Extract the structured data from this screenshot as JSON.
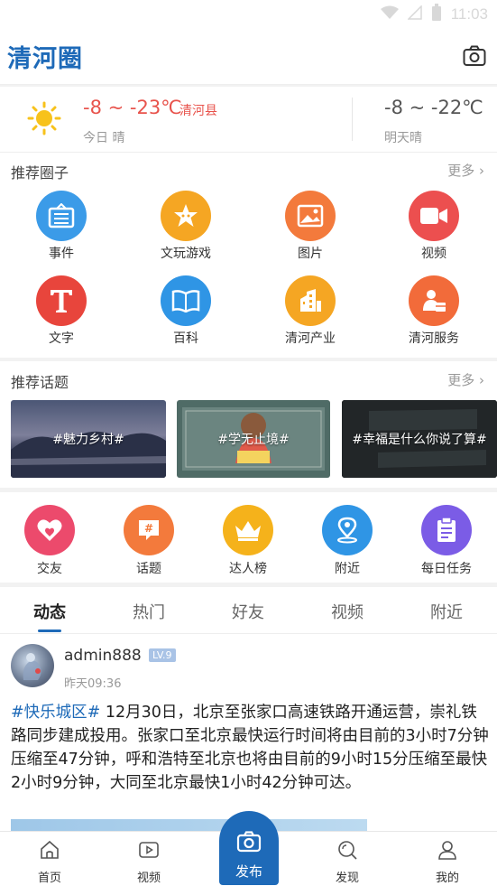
{
  "status_bar": {
    "time": "11:03"
  },
  "header": {
    "title": "清河圈",
    "camera_icon": "camera-icon"
  },
  "weather": {
    "today_temp": "-8 ~ -23℃",
    "city": "清河县",
    "today_cond": "今日 晴",
    "tomorrow_temp": "-8 ~ -22℃",
    "tomorrow_cond": "明天晴"
  },
  "circles": {
    "title": "推荐圈子",
    "more": "更多",
    "items": [
      {
        "label": "事件",
        "color": "#3b9be8",
        "icon": "news-icon"
      },
      {
        "label": "文玩游戏",
        "color": "#f5a623",
        "icon": "star-icon"
      },
      {
        "label": "图片",
        "color": "#f37a3c",
        "icon": "image-icon"
      },
      {
        "label": "视频",
        "color": "#ec4f4f",
        "icon": "video-icon"
      },
      {
        "label": "文字",
        "color": "#e8453c",
        "icon": "text-icon"
      },
      {
        "label": "百科",
        "color": "#2f95e5",
        "icon": "book-icon"
      },
      {
        "label": "清河产业",
        "color": "#f5a623",
        "icon": "building-icon"
      },
      {
        "label": "清河服务",
        "color": "#f26b3a",
        "icon": "service-icon"
      }
    ]
  },
  "topics": {
    "title": "推荐话题",
    "more": "更多",
    "items": [
      {
        "label": "#魅力乡村#"
      },
      {
        "label": "#学无止境#"
      },
      {
        "label": "#幸福是什么你说了算#"
      }
    ]
  },
  "shortcuts": [
    {
      "label": "交友",
      "color": "#ec4a6c",
      "icon": "heart-icon"
    },
    {
      "label": "话题",
      "color": "#f37a3c",
      "icon": "hashtag-icon"
    },
    {
      "label": "达人榜",
      "color": "#f5b21b",
      "icon": "crown-icon"
    },
    {
      "label": "附近",
      "color": "#2f95e5",
      "icon": "location-icon"
    },
    {
      "label": "每日任务",
      "color": "#7b5ce6",
      "icon": "clipboard-icon"
    }
  ],
  "feed": {
    "tabs": [
      "动态",
      "热门",
      "好友",
      "视频",
      "附近"
    ],
    "post": {
      "username": "admin888",
      "level": "LV.9",
      "time": "昨天09:36",
      "hashtag": "#快乐城区#",
      "text": " 12月30日，北京至张家口高速铁路开通运营，崇礼铁路同步建成投用。张家口至北京最快运行时间将由目前的3小时7分钟压缩至47分钟，呼和浩特至北京也将由目前的9小时15分压缩至最快2小时9分钟，大同至北京最快1小时42分钟可达。"
    }
  },
  "bottom_nav": {
    "home": "首页",
    "video": "视频",
    "publish": "发布",
    "discover": "发现",
    "mine": "我的"
  }
}
